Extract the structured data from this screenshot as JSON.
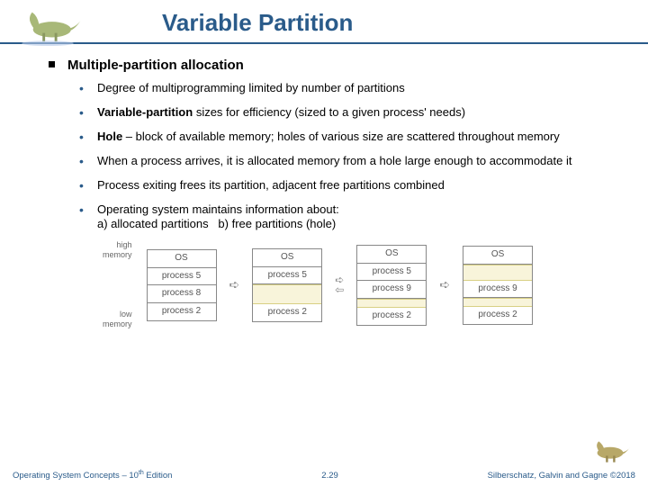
{
  "title": "Variable Partition",
  "main_bullet": "Multiple-partition allocation",
  "subs": [
    {
      "html": "Degree of multiprogramming limited by number of partitions"
    },
    {
      "html": "<span class='bold'>Variable-partition</span> sizes for efficiency (sized to a given process' needs)"
    },
    {
      "html": "<span class='bold'>Hole</span> – block of available memory; holes of various size are scattered throughout memory"
    },
    {
      "html": "When a process arrives, it is allocated memory from a hole large enough to accommodate it"
    },
    {
      "html": "Process exiting frees its partition, adjacent free partitions combined"
    },
    {
      "html": "Operating system maintains information about:<br>a) allocated partitions&nbsp;&nbsp;&nbsp;b) free partitions (hole)"
    }
  ],
  "mem": {
    "high": "high\nmemory",
    "low": "low\nmemory"
  },
  "cols": {
    "c1": [
      "OS",
      "process 5",
      "process 8",
      "process 2"
    ],
    "c2": [
      "OS",
      "process 5",
      "",
      "process 2"
    ],
    "c3": [
      "OS",
      "process 5",
      "process 9",
      "",
      "process 2"
    ],
    "c4": [
      "OS",
      "",
      "process 9",
      "",
      "process 2"
    ]
  },
  "footer": {
    "left_pre": "Operating System Concepts – 10",
    "left_sup": "th",
    "left_post": " Edition",
    "center": "2.29",
    "right": "Silberschatz, Galvin and Gagne ©2018"
  }
}
